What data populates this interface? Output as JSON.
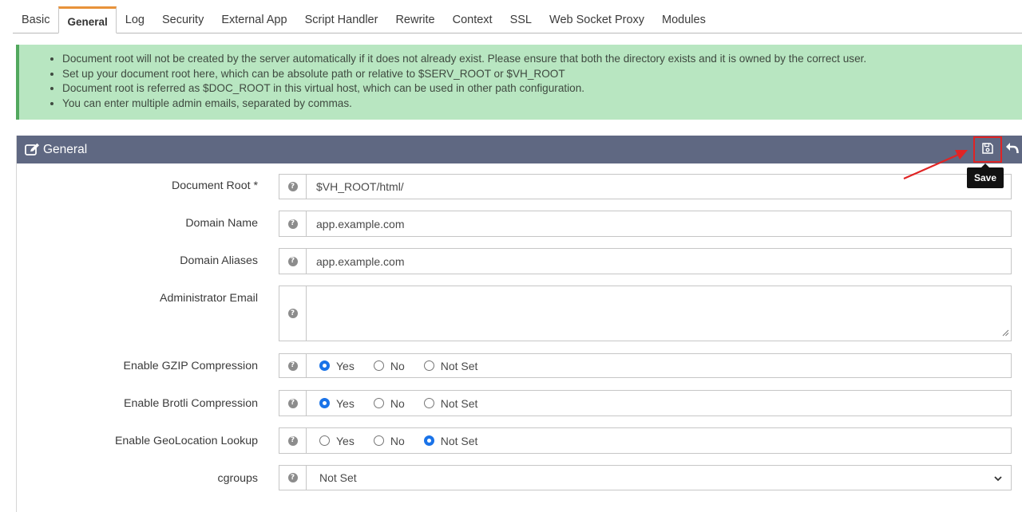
{
  "tabs": [
    "Basic",
    "General",
    "Log",
    "Security",
    "External App",
    "Script Handler",
    "Rewrite",
    "Context",
    "SSL",
    "Web Socket Proxy",
    "Modules"
  ],
  "active_tab": "General",
  "alert": {
    "items": [
      "Document root will not be created by the server automatically if it does not already exist. Please ensure that both the directory exists and it is owned by the correct user.",
      "Set up your document root here, which can be absolute path or relative to $SERV_ROOT or $VH_ROOT",
      "Document root is referred as $DOC_ROOT in this virtual host, which can be used in other path configuration.",
      "You can enter multiple admin emails, separated by commas."
    ]
  },
  "panel": {
    "title": "General",
    "save_tooltip": "Save",
    "help_glyph": "?"
  },
  "form": {
    "document_root": {
      "label": "Document Root *",
      "value": "$VH_ROOT/html/"
    },
    "domain_name": {
      "label": "Domain Name",
      "value": "app.example.com"
    },
    "domain_aliases": {
      "label": "Domain Aliases",
      "value": "app.example.com"
    },
    "admin_email": {
      "label": "Administrator Email",
      "value": ""
    },
    "gzip": {
      "label": "Enable GZIP Compression",
      "options": [
        "Yes",
        "No",
        "Not Set"
      ],
      "selected": "Yes"
    },
    "brotli": {
      "label": "Enable Brotli Compression",
      "options": [
        "Yes",
        "No",
        "Not Set"
      ],
      "selected": "Yes"
    },
    "geolocation": {
      "label": "Enable GeoLocation Lookup",
      "options": [
        "Yes",
        "No",
        "Not Set"
      ],
      "selected": "Not Set"
    },
    "cgroups": {
      "label": "cgroups",
      "value": "Not Set"
    }
  },
  "colors": {
    "tab_accent": "#e8923a",
    "alert_bg": "#b8e6c1",
    "alert_border": "#52a85e",
    "panel_header": "#5f6882",
    "highlight": "#e02424",
    "radio_on": "#1a73e8"
  },
  "icons": {
    "panel_title": "edit-icon",
    "save": "floppy-disk-icon",
    "undo": "undo-arrow-icon",
    "help": "question-circle-icon",
    "dropdown": "chevron-down-icon"
  }
}
